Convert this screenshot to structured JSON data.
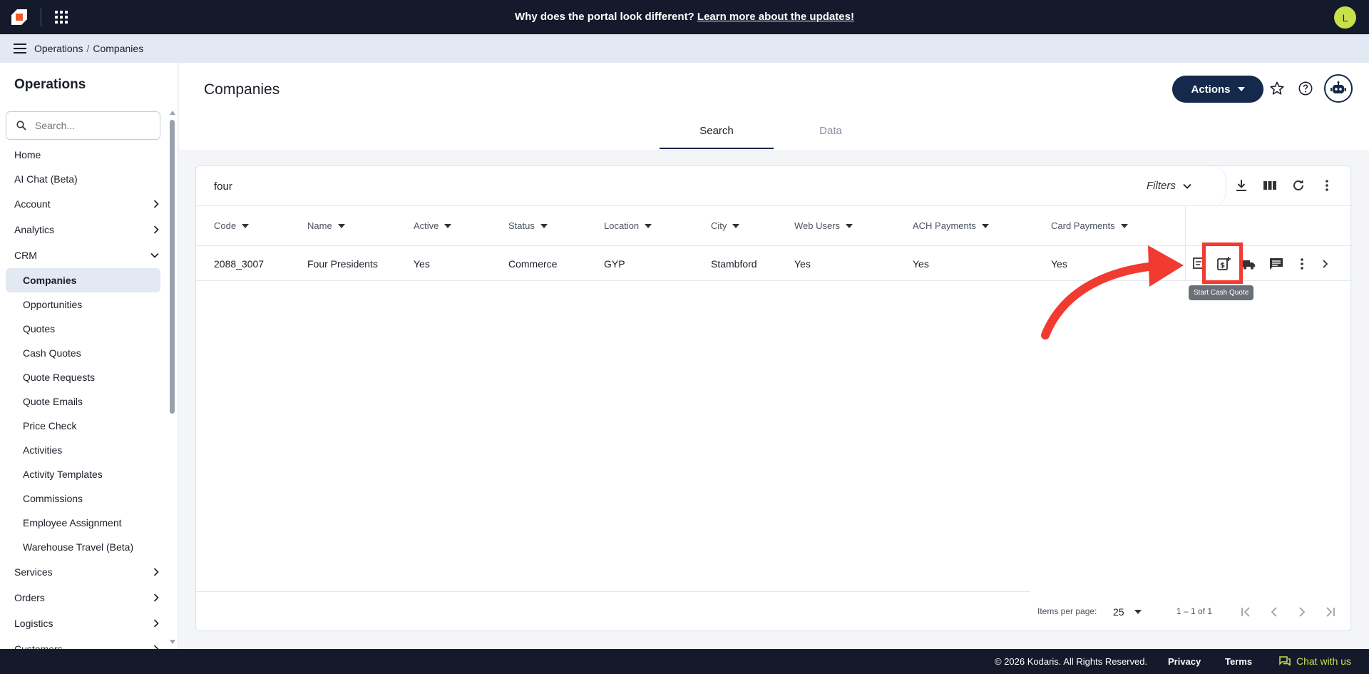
{
  "topbar": {
    "announcement_text": "Why does the portal look different?",
    "announcement_link": "Learn more about the updates!",
    "avatar_initial": "L"
  },
  "breadcrumb": {
    "section": "Operations",
    "page": "Companies"
  },
  "sidebar": {
    "title": "Operations",
    "search_placeholder": "Search...",
    "items": [
      {
        "label": "Home"
      },
      {
        "label": "AI Chat (Beta)"
      },
      {
        "label": "Account"
      },
      {
        "label": "Analytics"
      },
      {
        "label": "CRM"
      },
      {
        "label": "Companies"
      },
      {
        "label": "Opportunities"
      },
      {
        "label": "Quotes"
      },
      {
        "label": "Cash Quotes"
      },
      {
        "label": "Quote Requests"
      },
      {
        "label": "Quote Emails"
      },
      {
        "label": "Price Check"
      },
      {
        "label": "Activities"
      },
      {
        "label": "Activity Templates"
      },
      {
        "label": "Commissions"
      },
      {
        "label": "Employee Assignment"
      },
      {
        "label": "Warehouse Travel (Beta)"
      },
      {
        "label": "Services"
      },
      {
        "label": "Orders"
      },
      {
        "label": "Logistics"
      },
      {
        "label": "Customers"
      }
    ]
  },
  "header": {
    "title": "Companies",
    "actions_label": "Actions",
    "tabs": [
      {
        "label": "Search"
      },
      {
        "label": "Data"
      }
    ]
  },
  "search": {
    "value": "four",
    "filters_label": "Filters"
  },
  "table": {
    "columns": [
      "Code",
      "Name",
      "Active",
      "Status",
      "Location",
      "City",
      "Web Users",
      "ACH Payments",
      "Card Payments"
    ],
    "rows": [
      [
        "2088_3007",
        "Four Presidents",
        "Yes",
        "Commerce",
        "GYP",
        "Stambford",
        "Yes",
        "Yes",
        "Yes"
      ]
    ],
    "tooltip": "Start Cash Quote"
  },
  "pager": {
    "items_per_page_label": "Items per page:",
    "items_per_page": "25",
    "range": "1 – 1 of 1"
  },
  "footer": {
    "copyright": "© 2026 Kodaris. All Rights Reserved.",
    "privacy": "Privacy",
    "terms": "Terms",
    "chat": "Chat with us"
  },
  "colors": {
    "navy": "#14192b",
    "accent": "#14294b",
    "lime": "#c8e04a",
    "annotation_red": "#f13a30"
  }
}
